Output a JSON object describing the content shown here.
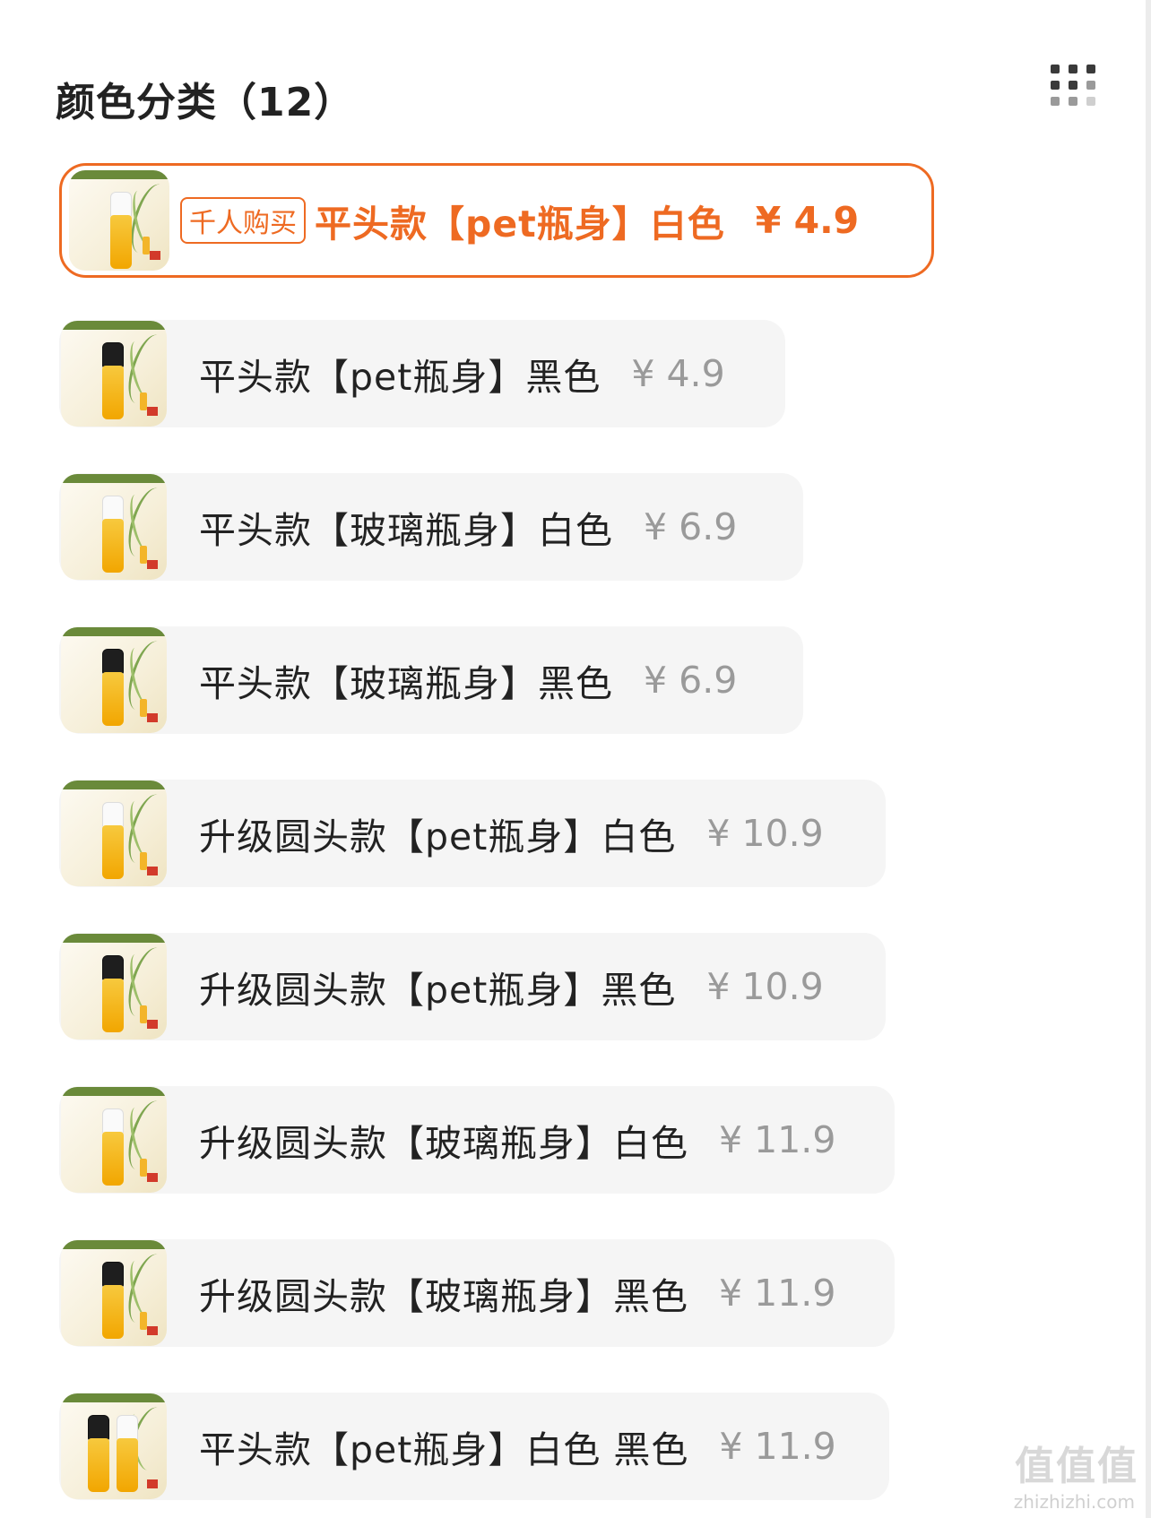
{
  "header": {
    "title": "颜色分类（12）"
  },
  "colors": {
    "accent": "#ee6a22",
    "option_bg": "#f5f5f5",
    "price_gray": "#9a9a9a"
  },
  "options": [
    {
      "label": "平头款【pet瓶身】白色",
      "price": "¥ 4.9",
      "badge": "千人购买",
      "selected": true,
      "cap": "white"
    },
    {
      "label": "平头款【pet瓶身】黑色",
      "price": "¥ 4.9",
      "cap": "black"
    },
    {
      "label": "平头款【玻璃瓶身】白色",
      "price": "¥ 6.9",
      "cap": "white"
    },
    {
      "label": "平头款【玻璃瓶身】黑色",
      "price": "¥ 6.9",
      "cap": "black"
    },
    {
      "label": "升级圆头款【pet瓶身】白色",
      "price": "¥ 10.9",
      "cap": "white"
    },
    {
      "label": "升级圆头款【pet瓶身】黑色",
      "price": "¥ 10.9",
      "cap": "black"
    },
    {
      "label": "升级圆头款【玻璃瓶身】白色",
      "price": "¥ 11.9",
      "cap": "white"
    },
    {
      "label": "升级圆头款【玻璃瓶身】黑色",
      "price": "¥ 11.9",
      "cap": "black"
    },
    {
      "label": "平头款【pet瓶身】白色 黑色",
      "price": "¥ 11.9",
      "cap": "black"
    }
  ],
  "icons": {
    "view_toggle": "grid-icon"
  },
  "watermark": {
    "text": "值值值",
    "sub": "zhizhizhi.com"
  }
}
